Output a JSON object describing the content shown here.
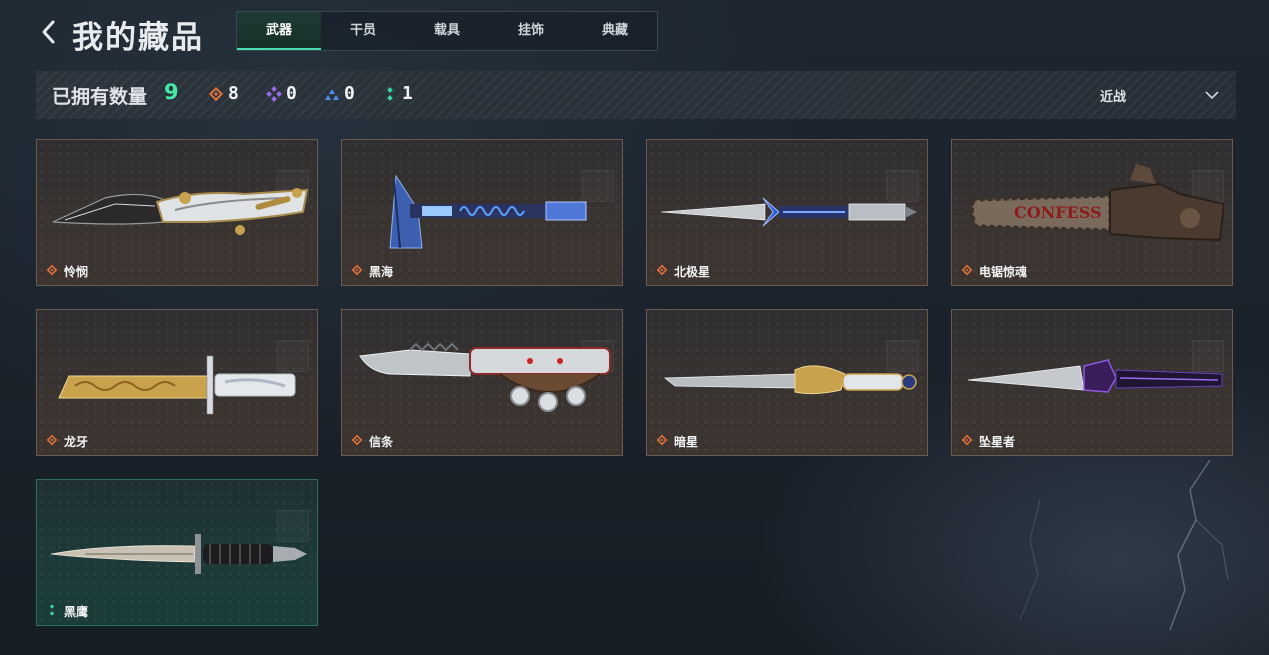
{
  "header": {
    "title": "我的藏品",
    "tabs": [
      {
        "label": "武器",
        "active": true
      },
      {
        "label": "干员",
        "active": false
      },
      {
        "label": "载具",
        "active": false
      },
      {
        "label": "挂饰",
        "active": false
      },
      {
        "label": "典藏",
        "active": false
      }
    ]
  },
  "stats": {
    "owned_label": "已拥有数量",
    "owned_count": "9",
    "rarity_counts": [
      {
        "icon": "orange-diamond-icon",
        "color": "#e0703a",
        "count": "8"
      },
      {
        "icon": "purple-diamond-icon",
        "color": "#9a6cf0",
        "count": "0"
      },
      {
        "icon": "blue-triangle-icon",
        "color": "#4a8ff0",
        "count": "0"
      },
      {
        "icon": "teal-dots-icon",
        "color": "#39d4b0",
        "count": "1"
      }
    ],
    "sort_label": "近战"
  },
  "items": [
    {
      "name": "怜悯",
      "rarity": "orange",
      "weapon": "butterfly-knife"
    },
    {
      "name": "黑海",
      "rarity": "orange",
      "weapon": "tomahawk"
    },
    {
      "name": "北极星",
      "rarity": "orange",
      "weapon": "dagger"
    },
    {
      "name": "电锯惊魂",
      "rarity": "orange",
      "weapon": "chainsaw",
      "weapon_text": "CONFESS"
    },
    {
      "name": "龙牙",
      "rarity": "orange",
      "weapon": "tanto-knife"
    },
    {
      "name": "信条",
      "rarity": "orange",
      "weapon": "knuckle-knife"
    },
    {
      "name": "暗星",
      "rarity": "orange",
      "weapon": "golden-dagger"
    },
    {
      "name": "坠星者",
      "rarity": "orange",
      "weapon": "dark-dagger"
    },
    {
      "name": "黑鹰",
      "rarity": "teal",
      "weapon": "combat-knife"
    }
  ],
  "colors": {
    "accent_green": "#46e8a6",
    "rarity_orange": "#e0703a",
    "rarity_teal": "#39d4b0"
  }
}
